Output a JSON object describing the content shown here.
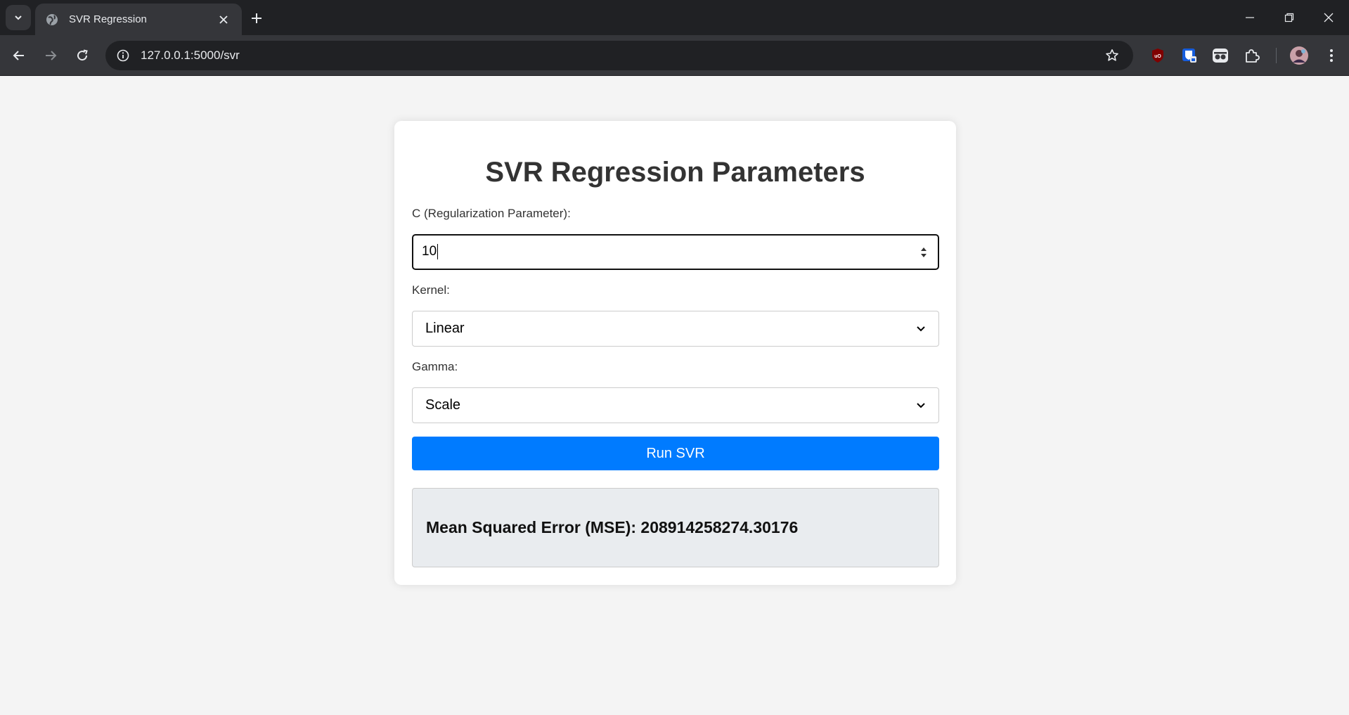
{
  "browser": {
    "tab_title": "SVR Regression",
    "url": "127.0.0.1:5000/svr"
  },
  "page": {
    "heading": "SVR Regression Parameters",
    "c_label": "C (Regularization Parameter):",
    "c_value": "10",
    "kernel_label": "Kernel:",
    "kernel_value": "Linear",
    "gamma_label": "Gamma:",
    "gamma_value": "Scale",
    "run_button": "Run SVR",
    "result_text": "Mean Squared Error (MSE): 208914258274.30176"
  },
  "colors": {
    "primary_button": "#007bff",
    "result_bg": "#e9ecef",
    "page_bg": "#f4f4f4"
  },
  "icons": [
    "tab-search-icon",
    "globe-icon",
    "close-icon",
    "plus-icon",
    "minimize-icon",
    "restore-icon",
    "window-close-icon",
    "back-icon",
    "forward-icon",
    "reload-icon",
    "info-icon",
    "star-icon",
    "ublock-icon",
    "bitwarden-icon",
    "incognito-glasses-icon",
    "puzzle-icon",
    "avatar",
    "kebab-menu-icon",
    "spinner-icon",
    "chevron-down-icon"
  ]
}
